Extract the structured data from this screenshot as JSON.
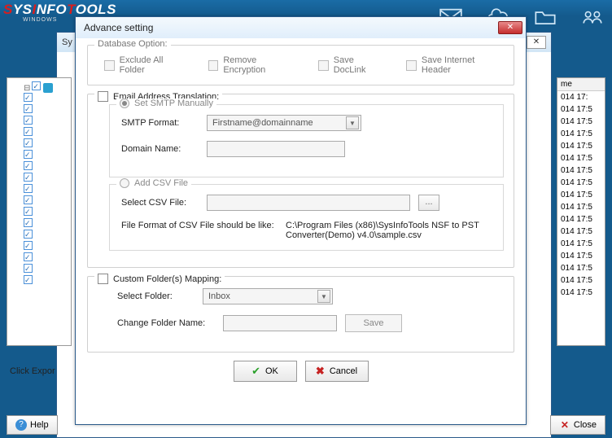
{
  "app": {
    "brand_part1": "S",
    "brand_part2": "YS",
    "brand_part3": "I",
    "brand_part4": "NFO",
    "brand_part5": "T",
    "brand_part6": "OOLS",
    "brand_sub": "WINDOWS"
  },
  "child_title": "Sy",
  "left_panel": {
    "items_count": 17
  },
  "click_export": "Click Expor",
  "right_col": {
    "header": "me",
    "rows": [
      "014 17:",
      "014 17:5",
      "014 17:5",
      "014 17:5",
      "014 17:5",
      "014 17:5",
      "014 17:5",
      "014 17:5",
      "014 17:5",
      "014 17:5",
      "014 17:5",
      "014 17:5",
      "014 17:5",
      "014 17:5",
      "014 17:5",
      "014 17:5",
      "014 17:5"
    ]
  },
  "dialog": {
    "title": "Advance setting",
    "db_option": {
      "legend": "Database Option:",
      "exclude_all": "Exclude All Folder",
      "remove_enc": "Remove Encryption",
      "save_doclink": "Save DocLink",
      "save_ih": "Save Internet Header"
    },
    "email_trans": {
      "toggle": "Email Address Translation:",
      "smtp": {
        "legend": "Set SMTP Manually",
        "format_label": "SMTP Format:",
        "format_value": "Firstname@domainname",
        "domain_label": "Domain Name:"
      },
      "csv": {
        "legend": "Add CSV File",
        "select_label": "Select CSV File:",
        "browse": "...",
        "hint_label": "File Format of CSV File should be like:",
        "hint_path": "C:\\Program Files (x86)\\SysInfoTools NSF to PST Converter(Demo) v4.0\\sample.csv"
      }
    },
    "mapping": {
      "toggle": "Custom Folder(s) Mapping:",
      "select_label": "Select Folder:",
      "select_value": "Inbox",
      "change_label": "Change Folder Name:",
      "save": "Save"
    },
    "buttons": {
      "ok": "OK",
      "cancel": "Cancel"
    }
  },
  "bottom": {
    "help": "Help",
    "close": "Close"
  }
}
